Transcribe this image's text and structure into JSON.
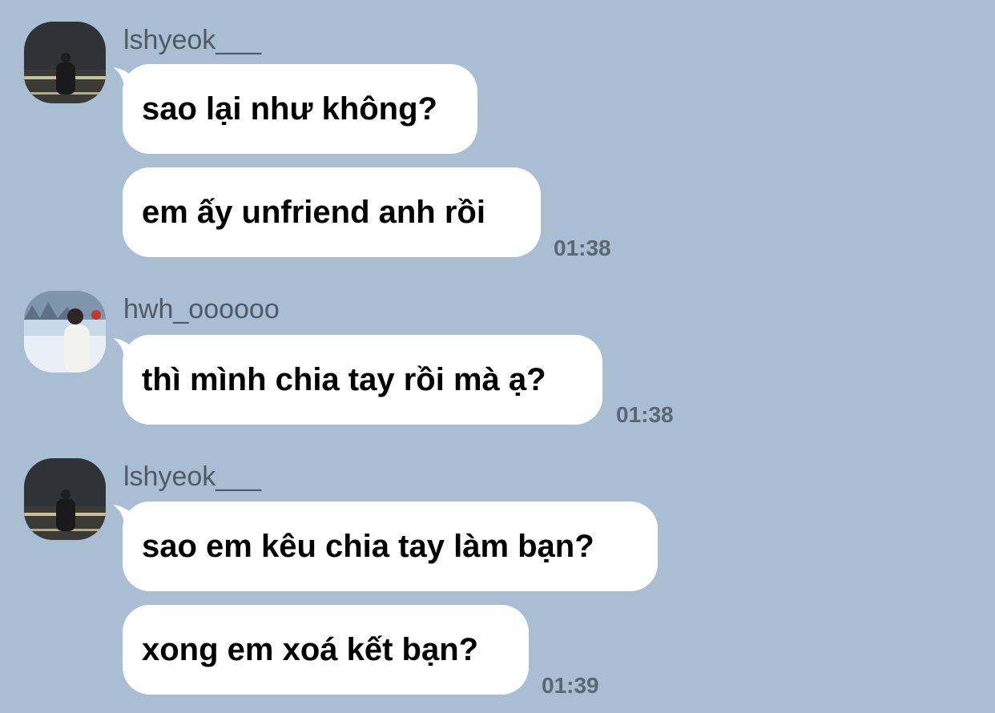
{
  "chat": {
    "groups": [
      {
        "sender": "lshyeok___",
        "messages": [
          "sao lại như không?",
          "em ấy unfriend anh rồi"
        ],
        "time": "01:38"
      },
      {
        "sender": "hwh_oooooo",
        "messages": [
          "thì mình chia tay rồi mà ạ?"
        ],
        "time": "01:38"
      },
      {
        "sender": "lshyeok___",
        "messages": [
          "sao em kêu chia tay làm bạn?",
          "xong em xoá kết bạn?"
        ],
        "time": "01:39"
      }
    ]
  },
  "colors": {
    "background": "#a9bed2",
    "bubble": "#ffffff",
    "username": "#4f5a66",
    "timestamp": "#5b6774"
  }
}
